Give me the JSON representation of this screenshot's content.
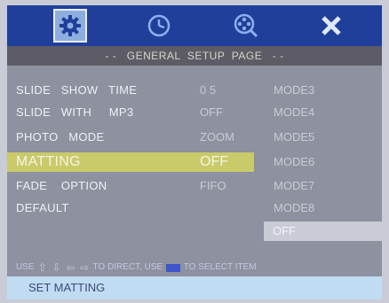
{
  "icons": [
    {
      "name": "gear-icon",
      "active": true
    },
    {
      "name": "clock-icon",
      "active": false
    },
    {
      "name": "film-reel-search-icon",
      "active": false
    },
    {
      "name": "close-icon",
      "active": false
    }
  ],
  "colors": {
    "icon_bar": "#1f3f9a",
    "highlight": "#c9ca6a",
    "panel": "#8e919f",
    "status_bar": "#c0dcf2"
  },
  "title": "- -   GENERAL  SETUP  PAGE   - -",
  "menu": [
    {
      "label": "SLIDE   SHOW   TIME",
      "value": "0 5"
    },
    {
      "label": "SLIDE   WITH     MP3",
      "value": "OFF"
    },
    {
      "label": "PHOTO   MODE",
      "value": "ZOOM"
    },
    {
      "label": "MATTING",
      "value": "OFF",
      "selected": true
    },
    {
      "label": "FADE    OPTION",
      "value": "FIFO"
    },
    {
      "label": "DEFAULT",
      "value": ""
    }
  ],
  "modes": [
    "MODE3",
    "MODE4",
    "MODE5",
    "MODE6",
    "MODE7",
    "MODE8"
  ],
  "mode_selected": "OFF",
  "hint": {
    "prefix": "USE",
    "middle": "TO DIRECT, USE",
    "suffix": "TO SELECT  ITEM"
  },
  "status": "SET MATTING"
}
